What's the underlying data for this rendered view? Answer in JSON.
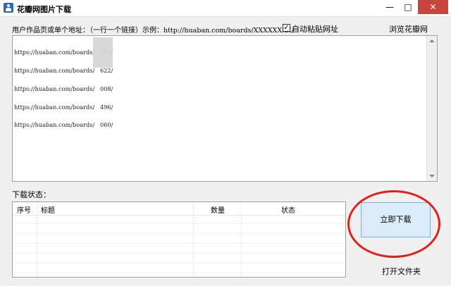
{
  "window": {
    "title": "花瓣网图片下载",
    "min_label": "—",
    "max_label": "□",
    "close_label": "✕"
  },
  "input": {
    "label": "用户作品页或单个地址：（一行一个链接）示例：",
    "example": "http://huaban.com/boards/XXXXXXXX/",
    "lines": [
      "https://huaban.com/boards/   413/",
      "https://huaban.com/boards/   622/",
      "https://huaban.com/boards/   008/",
      "https://huaban.com/boards/   496/",
      "https://huaban.com/boards/   060/"
    ]
  },
  "options": {
    "auto_paste_label": "自动粘贴网址",
    "auto_paste_checked": true,
    "browse_label": "浏览花瓣网"
  },
  "status": {
    "label": "下载状态：",
    "columns": [
      "序号",
      "标题",
      "数量",
      "状态"
    ]
  },
  "actions": {
    "download_label": "立即下载",
    "open_folder_label": "打开文件夹"
  },
  "colors": {
    "highlight": "#e0211c",
    "button_bg": "#dcebf8",
    "close_bg": "#c7453c"
  }
}
